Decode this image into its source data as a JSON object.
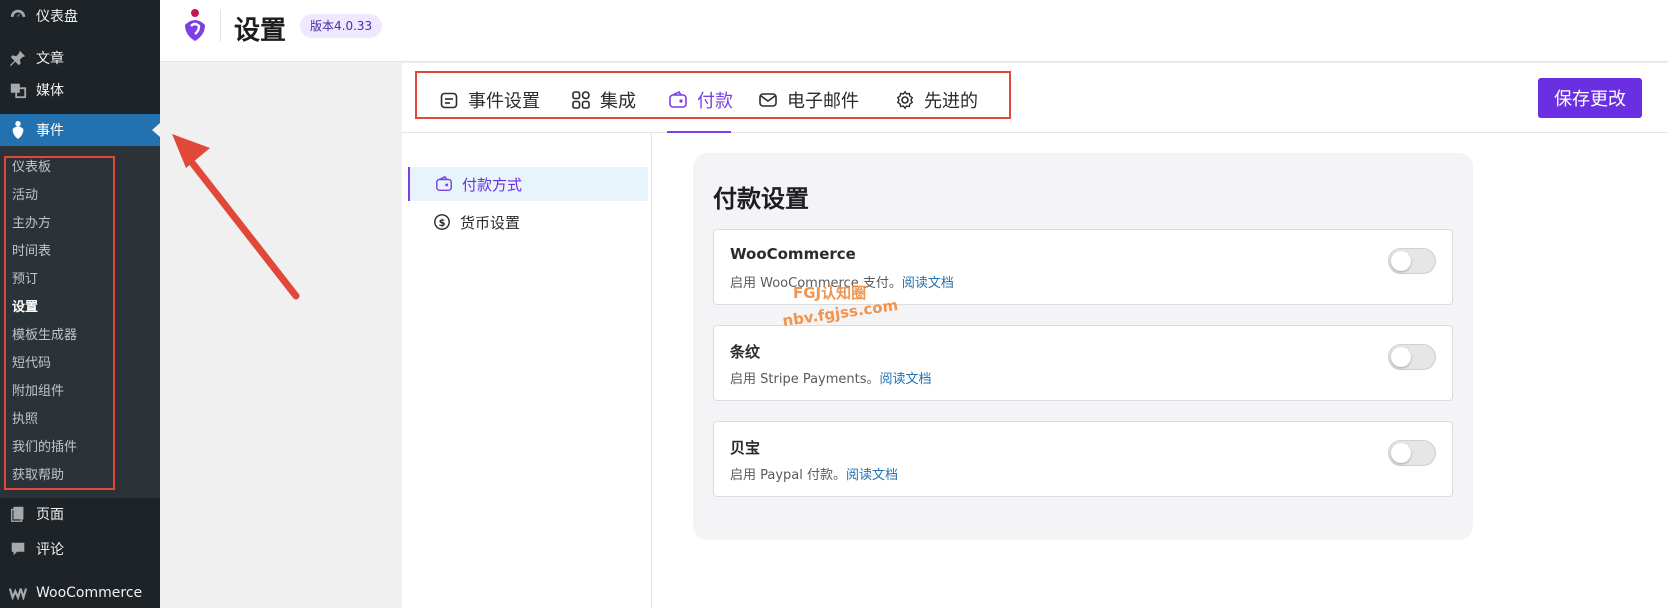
{
  "sidebar": {
    "items": [
      {
        "label": "仪表盘",
        "icon": "dashboard-icon"
      },
      {
        "label": "文章",
        "icon": "pin-icon"
      },
      {
        "label": "媒体",
        "icon": "media-icon"
      },
      {
        "label": "事件",
        "icon": "event-icon"
      },
      {
        "label": "页面",
        "icon": "page-icon"
      },
      {
        "label": "评论",
        "icon": "comment-icon"
      },
      {
        "label": "WooCommerce",
        "icon": "woocommerce-icon"
      }
    ],
    "submenu": [
      "仪表板",
      "活动",
      "主办方",
      "时间表",
      "预订",
      "设置",
      "模板生成器",
      "短代码",
      "附加组件",
      "执照",
      "我们的插件",
      "获取帮助"
    ]
  },
  "header": {
    "title": "设置",
    "version": "版本4.0.33"
  },
  "tabs": [
    {
      "label": "事件设置",
      "icon": "calendar-icon"
    },
    {
      "label": "集成",
      "icon": "grid-icon"
    },
    {
      "label": "付款",
      "icon": "wallet-icon"
    },
    {
      "label": "电子邮件",
      "icon": "mail-icon"
    },
    {
      "label": "先进的",
      "icon": "gear-icon"
    }
  ],
  "active_tab": "付款",
  "save_label": "保存更改",
  "subnav": [
    {
      "label": "付款方式",
      "icon": "wallet-icon"
    },
    {
      "label": "货币设置",
      "icon": "dollar-icon"
    }
  ],
  "panel": {
    "title": "付款设置",
    "gateways": [
      {
        "name": "WooCommerce",
        "desc": "启用 WooCommerce 支付。",
        "link": "阅读文档",
        "enabled": false
      },
      {
        "name": "条纹",
        "desc": "启用 Stripe Payments。",
        "link": "阅读文档",
        "enabled": false
      },
      {
        "name": "贝宝",
        "desc": "启用 Paypal 付款。",
        "link": "阅读文档",
        "enabled": false
      }
    ]
  },
  "watermark": {
    "line1": "FGJ认知圈",
    "line2": "nbv.fgjss.com"
  },
  "colors": {
    "accent": "#7b3fe4",
    "wp_blue": "#2271b1",
    "annotation": "#e0493a"
  }
}
